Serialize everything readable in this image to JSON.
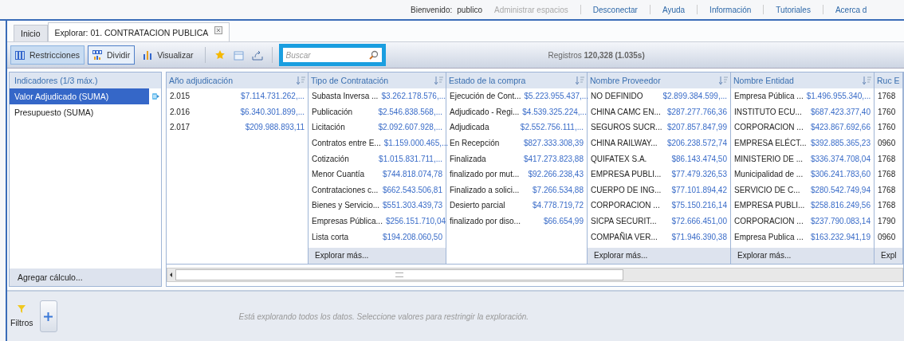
{
  "top_bar": {
    "welcome": "Bienvenido:",
    "user": "publico",
    "links": [
      {
        "label": "Administrar espacios",
        "disabled": true
      },
      {
        "label": "Desconectar",
        "disabled": false
      },
      {
        "label": "Ayuda",
        "disabled": false
      },
      {
        "label": "Información",
        "disabled": false
      },
      {
        "label": "Tutoriales",
        "disabled": false
      },
      {
        "label": "Acerca d",
        "disabled": false
      }
    ]
  },
  "tabs": [
    {
      "label": "Inicio",
      "selected": false,
      "closable": false
    },
    {
      "label": "Explorar: 01. CONTRATACION PUBLICA",
      "selected": true,
      "closable": true
    }
  ],
  "toolbar": {
    "buttons": [
      {
        "label": "Restricciones",
        "selected": true,
        "focused": false
      },
      {
        "label": "Dividir",
        "selected": false,
        "focused": true
      },
      {
        "label": "Visualizar",
        "selected": false,
        "focused": false
      }
    ],
    "search": {
      "placeholder": "Buscar"
    },
    "records": "Registros **120,328 (1.035s)**"
  },
  "indicators": {
    "title": "Indicadores (1/3 máx.)",
    "items": [
      {
        "label": "Valor Adjudicado (SUMA)",
        "selected": true
      },
      {
        "label": "Presupuesto (SUMA)",
        "selected": false
      }
    ],
    "add": "Agregar cálculo..."
  },
  "columns": [
    {
      "title": "Año adjudicación",
      "sortable": true,
      "rows": [
        {
          "label": "2.015",
          "value": "$7.114.731.262,..."
        },
        {
          "label": "2.016",
          "value": "$6.340.301.899,..."
        },
        {
          "label": "2.017",
          "value": "$209.988.893,11"
        }
      ]
    },
    {
      "title": "Tipo de Contratación",
      "sortable": true,
      "more": "Explorar más...",
      "rows": [
        {
          "label": "Subasta Inversa ...",
          "value": "$3.262.178.576,..."
        },
        {
          "label": "Publicación",
          "value": "$2.546.838.568,..."
        },
        {
          "label": "Licitación",
          "value": "$2.092.607.928,..."
        },
        {
          "label": "Contratos entre E...",
          "value": "$1.159.000.465,..."
        },
        {
          "label": "Cotización",
          "value": "$1.015.831.711,..."
        },
        {
          "label": "Menor Cuantía",
          "value": "$744.818.074,78"
        },
        {
          "label": "Contrataciones c...",
          "value": "$662.543.506,81"
        },
        {
          "label": "Bienes y Servicio...",
          "value": "$551.303.439,73"
        },
        {
          "label": "Empresas Pública...",
          "value": "$256.151.710,04"
        },
        {
          "label": "Lista corta",
          "value": "$194.208.060,50"
        }
      ]
    },
    {
      "title": "Estado de la compra",
      "sortable": true,
      "rows": [
        {
          "label": "Ejecución de Cont...",
          "value": "$5.223.955.437,..."
        },
        {
          "label": "Adjudicado - Regi...",
          "value": "$4.539.325.224,..."
        },
        {
          "label": "Adjudicada",
          "value": "$2.552.756.111,..."
        },
        {
          "label": "En Recepción",
          "value": "$827.333.308,39"
        },
        {
          "label": "Finalizada",
          "value": "$417.273.823,88"
        },
        {
          "label": "finalizado por mut...",
          "value": "$92.266.238,43"
        },
        {
          "label": "Finalizado a solici...",
          "value": "$7.266.534,88"
        },
        {
          "label": "Desierto parcial",
          "value": "$4.778.719,72"
        },
        {
          "label": "finalizado por diso...",
          "value": "$66.654,99"
        }
      ]
    },
    {
      "title": "Nombre Proveedor",
      "sortable": true,
      "more": "Explorar más...",
      "rows": [
        {
          "label": "NO DEFINIDO",
          "value": "$2.899.384.599,..."
        },
        {
          "label": "CHINA CAMC EN...",
          "value": "$287.277.766,36"
        },
        {
          "label": "SEGUROS SUCR...",
          "value": "$207.857.847,99"
        },
        {
          "label": "CHINA RAILWAY...",
          "value": "$206.238.572,74"
        },
        {
          "label": "QUIFATEX S.A.",
          "value": "$86.143.474,50"
        },
        {
          "label": "EMPRESA PUBLI...",
          "value": "$77.479.326,53"
        },
        {
          "label": "CUERPO DE ING...",
          "value": "$77.101.894,42"
        },
        {
          "label": "CORPORACION ...",
          "value": "$75.150.216,14"
        },
        {
          "label": "SICPA SECURIT...",
          "value": "$72.666.451,00"
        },
        {
          "label": "COMPAÑIA VER...",
          "value": "$71.946.390,38"
        }
      ]
    },
    {
      "title": "Nombre Entidad",
      "sortable": true,
      "more": "Explorar más...",
      "rows": [
        {
          "label": "Empresa Pública ...",
          "value": "$1.496.955.340,..."
        },
        {
          "label": "INSTITUTO ECU...",
          "value": "$687.423.377,40"
        },
        {
          "label": "CORPORACION ...",
          "value": "$423.867.692,66"
        },
        {
          "label": "EMPRESA ELÉCT...",
          "value": "$392.885.365,23"
        },
        {
          "label": "MINISTERIO DE ...",
          "value": "$336.374.708,04"
        },
        {
          "label": "Municipalidad de ...",
          "value": "$306.241.783,60"
        },
        {
          "label": "SERVICIO DE C...",
          "value": "$280.542.749,94"
        },
        {
          "label": "EMPRESA PUBLI...",
          "value": "$258.816.249,56"
        },
        {
          "label": "CORPORACION ...",
          "value": "$237.790.083,14"
        },
        {
          "label": "Empresa Publica ...",
          "value": "$163.232.941,19"
        }
      ]
    },
    {
      "title": "Ruc E",
      "more": "Expl",
      "rows": [
        {
          "label": "1768"
        },
        {
          "label": "1760"
        },
        {
          "label": "1760"
        },
        {
          "label": "0960"
        },
        {
          "label": "1768"
        },
        {
          "label": "1768"
        },
        {
          "label": "1768"
        },
        {
          "label": "1768"
        },
        {
          "label": "1790"
        },
        {
          "label": "0960"
        }
      ]
    }
  ],
  "filters": {
    "label": "Filtros",
    "message": "Está explorando todos los datos. Seleccione valores para restringir la exploración."
  }
}
